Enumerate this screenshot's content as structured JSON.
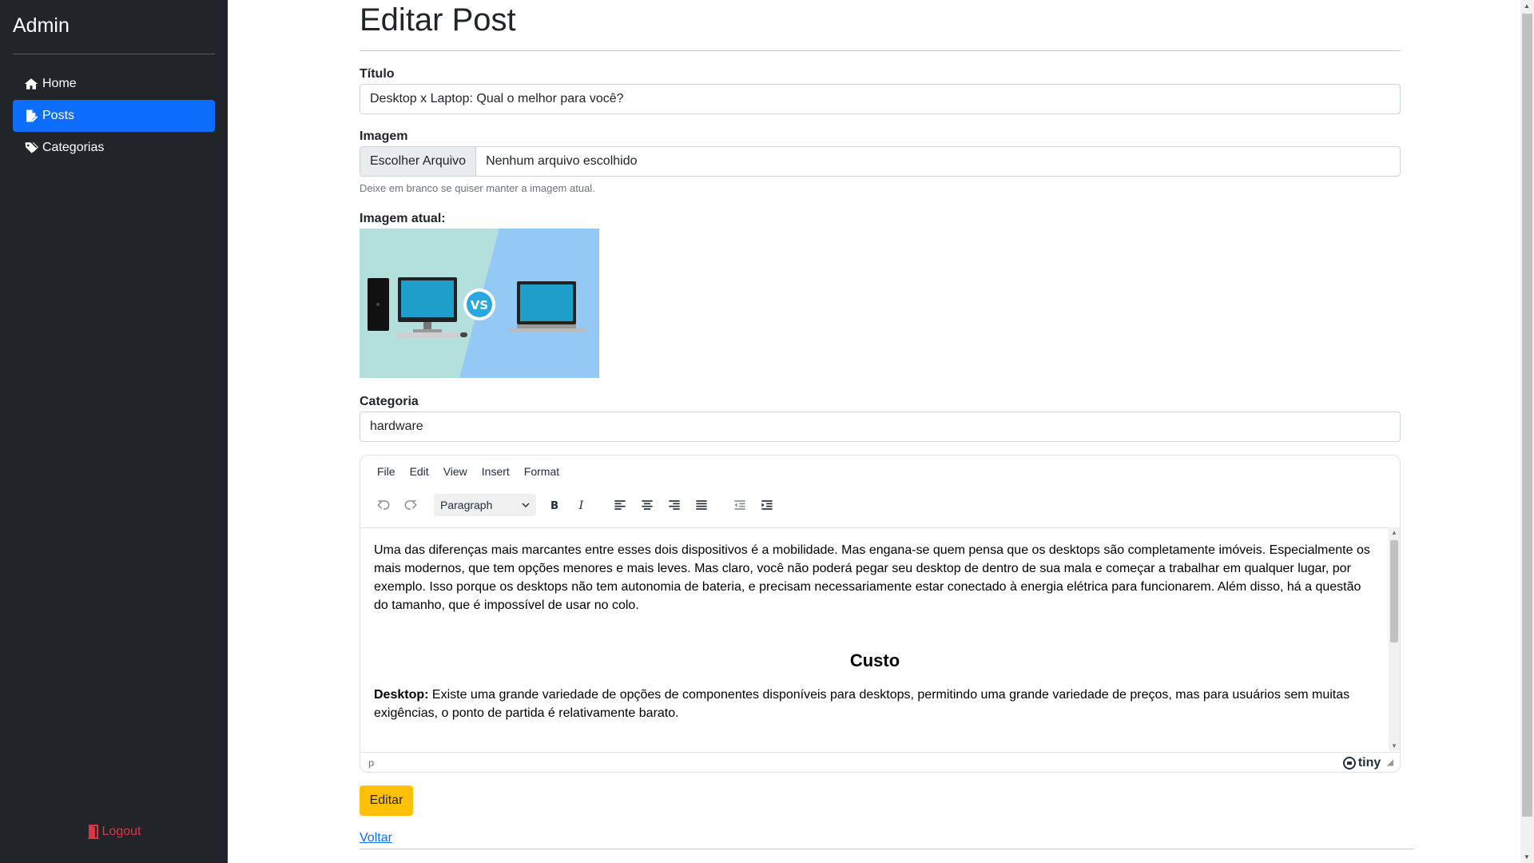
{
  "sidebar": {
    "brand": "Admin",
    "items": [
      {
        "label": "Home",
        "icon": "home-icon",
        "active": false
      },
      {
        "label": "Posts",
        "icon": "file-edit-icon",
        "active": true
      },
      {
        "label": "Categorias",
        "icon": "tags-icon",
        "active": false
      }
    ],
    "logout_label": "Logout"
  },
  "main": {
    "page_title": "Editar Post",
    "titulo_label": "Título",
    "titulo_value": "Desktop x Laptop: Qual o melhor para você?",
    "imagem_label": "Imagem",
    "file_button": "Escolher Arquivo",
    "file_status": "Nenhum arquivo escolhido",
    "imagem_help": "Deixe em branco se quiser manter a imagem atual.",
    "imagem_atual_label": "Imagem atual:",
    "thumb_badge": "VS",
    "categoria_label": "Categoria",
    "categoria_value": "hardware",
    "editor": {
      "menu": [
        "File",
        "Edit",
        "View",
        "Insert",
        "Format"
      ],
      "block_format": "Paragraph",
      "paragraph1": "Uma das diferenças mais marcantes entre esses dois dispositivos é a mobilidade. Mas engana-se quem pensa que os desktops são completamente imóveis. Especialmente os mais modernos, que tem opções menores e mais leves. Mas claro, você não poderá pegar seu desktop de dentro de sua mala e começar a trabalhar em qualquer lugar, por exemplo. Isso porque os desktops não tem autonomia de bateria, e precisam necessariamente estar conectado à energia elétrica para funcionarem. Além disso, há a questão do tamanho, que é impossível de usar no colo.",
      "heading": "Custo",
      "paragraph2_bold": "Desktop:",
      "paragraph2_rest": " Existe uma grande variedade de opções de componentes disponíveis para desktops, permitindo uma grande variedade de preços, mas para usuários sem muitas exigências, o ponto de partida é relativamente barato.",
      "status_path": "p",
      "brand": "tiny"
    },
    "submit_label": "Editar",
    "back_label": "Voltar"
  },
  "colors": {
    "sidebar_bg": "#212529",
    "active_nav": "#0d6efd",
    "logout": "#dc3545",
    "submit": "#ffc107",
    "link": "#0d6efd"
  }
}
